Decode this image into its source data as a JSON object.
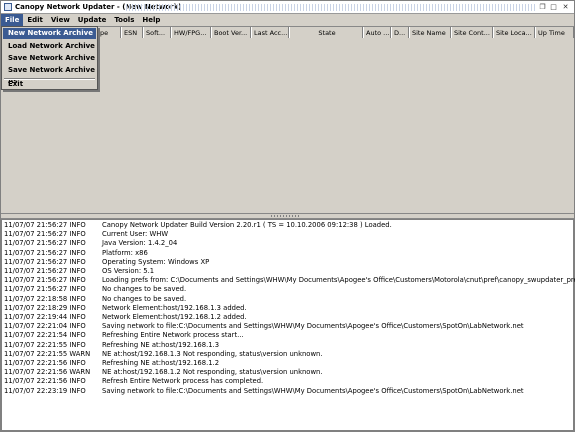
{
  "window": {
    "title": "Canopy Network Updater - (New Network)"
  },
  "menubar": [
    "File",
    "Edit",
    "View",
    "Update",
    "Tools",
    "Help"
  ],
  "file_menu": {
    "items": [
      "New Network Archive",
      "Load Network Archive",
      "Save Network Archive",
      "Save Network Archive As"
    ],
    "exit": "Exit"
  },
  "table": {
    "columns": [
      "pe",
      "ESN",
      "Soft...",
      "HW/FPG...",
      "Boot Ver...",
      "Last Acc...",
      "State",
      "Auto ...",
      "D...",
      "Site Name",
      "Site Cont...",
      "Site Loca...",
      "Up Time"
    ]
  },
  "log": [
    {
      "ts": "11/07/07 21:56:27 INFO",
      "msg": "Canopy Network Updater Build Version 2.20.r1  ( TS = 10.10.2006 09:12:38 ) Loaded."
    },
    {
      "ts": "11/07/07 21:56:27 INFO",
      "msg": "Current User: WHW"
    },
    {
      "ts": "11/07/07 21:56:27 INFO",
      "msg": "Java Version: 1.4.2_04"
    },
    {
      "ts": "11/07/07 21:56:27 INFO",
      "msg": "Platform: x86"
    },
    {
      "ts": "11/07/07 21:56:27 INFO",
      "msg": "Operating System: Windows XP"
    },
    {
      "ts": "11/07/07 21:56:27 INFO",
      "msg": "OS Version: 5.1"
    },
    {
      "ts": "11/07/07 21:56:27 INFO",
      "msg": "Loading prefs from: C:\\Documents and Settings\\WHW\\My Documents\\Apogee's Office\\Customers\\Motorola\\cnut\\pref\\canopy_swupdater_pref.txt"
    },
    {
      "ts": "11/07/07 21:56:27 INFO",
      "msg": "No changes to be saved."
    },
    {
      "ts": "11/07/07 22:18:58 INFO",
      "msg": "No changes to be saved."
    },
    {
      "ts": "11/07/07 22:18:29 INFO",
      "msg": "Network Element:host/192.168.1.3 added."
    },
    {
      "ts": "11/07/07 22:19:44 INFO",
      "msg": "Network Element:host/192.168.1.2 added."
    },
    {
      "ts": "11/07/07 22:21:04 INFO",
      "msg": "Saving network to file:C:\\Documents and Settings\\WHW\\My Documents\\Apogee's Office\\Customers\\SpotOn\\LabNetwork.net"
    },
    {
      "ts": "11/07/07 22:21:54 INFO",
      "msg": "Refreshing Entire Network process start..."
    },
    {
      "ts": "11/07/07 22:21:55 INFO",
      "msg": "Refreshing NE at:host/192.168.1.3"
    },
    {
      "ts": "11/07/07 22:21:55 WARN",
      "msg": "NE at:host/192.168.1.3 Not responding, status\\version unknown."
    },
    {
      "ts": "11/07/07 22:21:56 INFO",
      "msg": "Refreshing NE at:host/192.168.1.2"
    },
    {
      "ts": "11/07/07 22:21:56 WARN",
      "msg": "NE at:host/192.168.1.2 Not responding, status\\version unknown."
    },
    {
      "ts": "11/07/07 22:21:56 INFO",
      "msg": "Refresh Entire Network process has completed."
    },
    {
      "ts": "11/07/07 22:23:19 INFO",
      "msg": "Saving network to file:C:\\Documents and Settings\\WHW\\My Documents\\Apogee's Office\\Customers\\SpotOn\\LabNetwork.net"
    }
  ],
  "colors": {
    "menu_highlight": "#3b5b92",
    "window_bg": "#d4d0c8"
  }
}
